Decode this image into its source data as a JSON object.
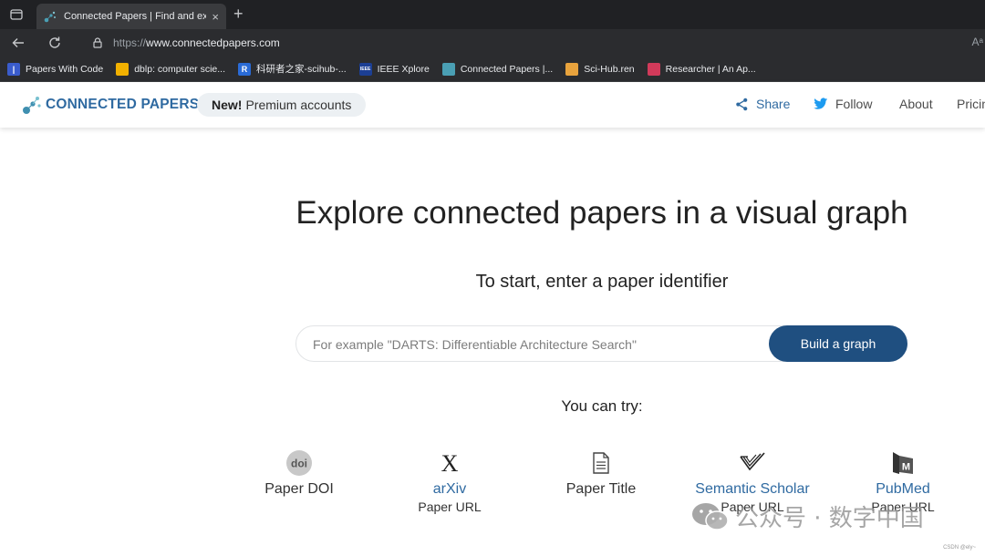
{
  "browser": {
    "tab_title": "Connected Papers | Find and exp",
    "new_tab_symbol": "+",
    "close_symbol": "×",
    "url_scheme": "https://",
    "url_host": "www.connectedpapers.com",
    "reader_symbol": "Aᵃ"
  },
  "bookmarks": [
    {
      "label": "Papers With Code",
      "icon": "pwc-icon",
      "color": "#3a5ccc",
      "glyph": "|"
    },
    {
      "label": "dblp: computer scie...",
      "icon": "dblp-icon",
      "color": "#f2b100",
      "glyph": ""
    },
    {
      "label": "科研者之家-scihub-...",
      "icon": "r-icon",
      "color": "#2a6bd6",
      "glyph": "R"
    },
    {
      "label": "IEEE Xplore",
      "icon": "ieee-icon",
      "color": "#1c3f94",
      "glyph": "IEEE"
    },
    {
      "label": "Connected Papers |...",
      "icon": "connectedpapers-icon",
      "color": "#4a9fb4",
      "glyph": ""
    },
    {
      "label": "Sci-Hub.ren",
      "icon": "scihub-icon",
      "color": "#e8a33d",
      "glyph": ""
    },
    {
      "label": "Researcher | An Ap...",
      "icon": "researcher-icon",
      "color": "#d13a5a",
      "glyph": ""
    }
  ],
  "header": {
    "logo_text": "CONNECTED PAPERS",
    "premium_new": "New!",
    "premium_text": "Premium accounts",
    "share": "Share",
    "follow": "Follow",
    "about": "About",
    "pricing": "Pricin"
  },
  "main": {
    "headline": "Explore connected papers in a visual graph",
    "subline": "To start, enter a paper identifier",
    "search_placeholder": "For example \"DARTS: Differentiable Architecture Search\"",
    "build_button": "Build a graph",
    "you_can_try": "You can try:"
  },
  "options": [
    {
      "name": "paper-doi",
      "label": "Paper DOI",
      "sub": "",
      "link": false,
      "icon": "doi-icon"
    },
    {
      "name": "arxiv",
      "label": "arXiv",
      "sub": "Paper URL",
      "link": true,
      "icon": "arxiv-x-icon"
    },
    {
      "name": "paper-title",
      "label": "Paper Title",
      "sub": "",
      "link": false,
      "icon": "document-icon"
    },
    {
      "name": "semantic-scholar",
      "label": "Semantic Scholar",
      "sub": "Paper URL",
      "link": true,
      "icon": "semantic-scholar-icon"
    },
    {
      "name": "pubmed",
      "label": "PubMed",
      "sub": "Paper URL",
      "link": true,
      "icon": "pubmed-icon"
    }
  ],
  "watermark": {
    "text": "公众号 · 数字中国",
    "credit": "CSDN @ely~"
  },
  "colors": {
    "brand": "#2f6aa1",
    "button": "#1f4f80",
    "link": "#2f6aa1"
  }
}
